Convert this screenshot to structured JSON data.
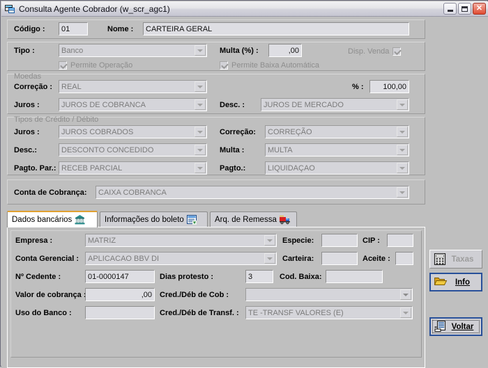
{
  "window": {
    "title": "Consulta Agente Cobrador (w_scr_agc1)",
    "icon": "app-window-icon",
    "controls": {
      "minimize": "minimize-icon",
      "maximize": "maximize-icon",
      "close": "close-icon"
    }
  },
  "header": {
    "codigo_label": "Código :",
    "codigo_value": "01",
    "nome_label": "Nome :",
    "nome_value": "CARTEIRA GERAL"
  },
  "tipo_group": {
    "tipo_label": "Tipo :",
    "tipo_value": "Banco",
    "multa_label": "Multa (%) :",
    "multa_value": ",00",
    "disp_venda_label": "Disp. Venda",
    "disp_venda_checked": true,
    "permite_operacao_label": "Permite Operação",
    "permite_operacao_checked": true,
    "permite_baixa_label": "Permite Baixa Automática",
    "permite_baixa_checked": true
  },
  "moedas_group": {
    "group_label": "Moedas",
    "correcao_label": "Correção :",
    "correcao_value": "REAL",
    "percent_label": "% :",
    "percent_value": "100,00",
    "juros_label": "Juros :",
    "juros_value": "JUROS DE COBRANCA",
    "desc_label": "Desc. :",
    "desc_value": "JUROS DE MERCADO"
  },
  "tipos_credito_group": {
    "group_label": "Tipos de Crédito / Débito",
    "juros_label": "Juros :",
    "juros_value": "JUROS COBRADOS",
    "correcao_label": "Correção:",
    "correcao_value": "CORREÇÃO",
    "desc_label": "Desc.:",
    "desc_value": "DESCONTO CONCEDIDO",
    "multa_label": "Multa :",
    "multa_value": "MULTA",
    "pagto_par_label": "Pagto. Par.:",
    "pagto_par_value": "RECEB PARCIAL",
    "pagto_label": "Pagto.:",
    "pagto_value": "LIQUIDAÇAO"
  },
  "conta_cobranca": {
    "label": "Conta de Cobrança:",
    "value": "CAIXA COBRANCA"
  },
  "tabs": [
    {
      "label": "Dados bancários",
      "icon": "bank-icon",
      "active": true
    },
    {
      "label": "Informações do boleto",
      "icon": "document-form-icon",
      "active": false
    },
    {
      "label": "Arq. de Remessa",
      "icon": "delivery-truck-icon",
      "active": false
    }
  ],
  "dados_bancarios": {
    "empresa_label": "Empresa :",
    "empresa_value": "MATRIZ",
    "especie_label": "Especie:",
    "especie_value": "",
    "cip_label": "CIP :",
    "cip_value": "",
    "conta_gerencial_label": "Conta Gerencial :",
    "conta_gerencial_value": "APLICACAO BBV DI",
    "carteira_label": "Carteira:",
    "carteira_value": "",
    "aceite_label": "Aceite :",
    "aceite_value": "",
    "cedente_label": "Nº Cedente :",
    "cedente_value": "01-0000147",
    "dias_protesto_label": "Dias protesto :",
    "dias_protesto_value": "3",
    "cod_baixa_label": "Cod. Baixa:",
    "cod_baixa_value": "",
    "valor_cobranca_label": "Valor de cobrança :",
    "valor_cobranca_value": ",00",
    "cred_deb_cob_label": "Cred./Déb de Cob :",
    "cred_deb_cob_value": "",
    "uso_banco_label": "Uso do Banco :",
    "uso_banco_value": "",
    "cred_deb_transf_label": "Cred./Déb de Transf. :",
    "cred_deb_transf_value": "TE -TRANSF VALORES (E)"
  },
  "buttons": {
    "taxas": {
      "label": "Taxas",
      "icon": "calculator-icon",
      "disabled": true
    },
    "info": {
      "label": "Info",
      "icon": "open-folder-icon",
      "disabled": false
    },
    "voltar": {
      "label": "Voltar",
      "icon": "form-back-icon",
      "disabled": false
    }
  },
  "colors": {
    "window_bg": "#bfbfbf",
    "field_bg": "#dedee3",
    "combo_disabled_text": "#7b7b7b",
    "active_tab_accent": "#e0a030",
    "focus_border": "#28509a",
    "close_button": "#e04a30"
  }
}
